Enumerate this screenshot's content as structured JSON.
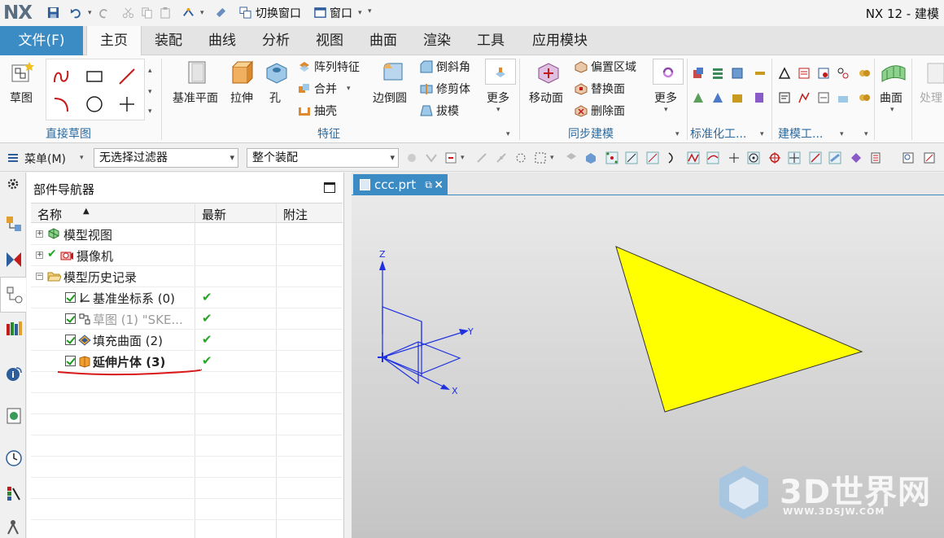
{
  "window": {
    "logo": "NX",
    "title": "NX 12 - 建模"
  },
  "quick_access": {
    "switch_window": "切换窗口",
    "window": "窗口"
  },
  "menu": {
    "file": "文件(F)",
    "tabs": [
      "主页",
      "装配",
      "曲线",
      "分析",
      "视图",
      "曲面",
      "渲染",
      "工具",
      "应用模块"
    ],
    "active_tab": "主页"
  },
  "ribbon": {
    "sketch": "草图",
    "direct_sketch_group": "直接草图",
    "datum_plane": "基准平面",
    "extrude": "拉伸",
    "hole": "孔",
    "pattern_feature": "阵列特征",
    "unite": "合并",
    "shell": "抽壳",
    "edge_blend": "边倒圆",
    "chamfer": "倒斜角",
    "trim_body": "修剪体",
    "draft": "拔模",
    "more": "更多",
    "feature_group": "特征",
    "move_face": "移动面",
    "offset_region": "偏置区域",
    "replace_face": "替换面",
    "delete_face": "删除面",
    "more2": "更多",
    "sync_group": "同步建模",
    "std_tools_group": "标准化工...",
    "modeling_tools_group": "建模工...",
    "surface": "曲面",
    "process": "处理"
  },
  "selection_bar": {
    "menu": "菜单(M)",
    "filter": "无选择过滤器",
    "scope": "整个装配"
  },
  "navigator": {
    "title": "部件导航器",
    "columns": [
      "名称",
      "最新",
      "附注"
    ],
    "rows": [
      {
        "name": "模型视图",
        "latest": "",
        "checkbox": false,
        "expander": "+"
      },
      {
        "name": "摄像机",
        "latest": "",
        "checkbox": false,
        "expander": "+"
      },
      {
        "name": "模型历史记录",
        "latest": "",
        "checkbox": false,
        "expander": "−"
      },
      {
        "name": "基准坐标系 (0)",
        "latest": "✔",
        "checkbox": true
      },
      {
        "name": "草图 (1) \"SKE...",
        "latest": "✔",
        "checkbox": true
      },
      {
        "name": "填充曲面 (2)",
        "latest": "✔",
        "checkbox": true
      },
      {
        "name": "延伸片体 (3)",
        "latest": "✔",
        "checkbox": true
      }
    ]
  },
  "graphics": {
    "tab_label": "ccc.prt",
    "axes": {
      "z": "Z",
      "y": "Y",
      "x": "X"
    },
    "sheet_color": "#ffff00"
  },
  "watermark": {
    "brand": "3D世界网",
    "url": "WWW.3DSJW.COM"
  }
}
